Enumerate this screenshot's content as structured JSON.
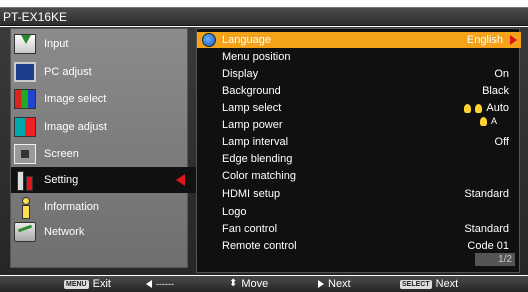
{
  "title": "PT-EX16KE",
  "sidebar": {
    "items": [
      {
        "label": "Input",
        "icon": "input-icon"
      },
      {
        "label": "PC adjust",
        "icon": "pc-adjust-icon"
      },
      {
        "label": "Image select",
        "icon": "image-select-icon"
      },
      {
        "label": "Image adjust",
        "icon": "image-adjust-icon"
      },
      {
        "label": "Screen",
        "icon": "screen-icon"
      },
      {
        "label": "Setting",
        "icon": "setting-icon",
        "selected": true
      },
      {
        "label": "Information",
        "icon": "information-icon"
      },
      {
        "label": "Network",
        "icon": "network-icon"
      }
    ]
  },
  "panel": {
    "rows": [
      {
        "label": "Language",
        "value": "English",
        "selected": true
      },
      {
        "label": "Menu position",
        "value": ""
      },
      {
        "label": "Display",
        "value": "On"
      },
      {
        "label": "Background",
        "value": "Black"
      },
      {
        "label": "Lamp select",
        "value": "Auto"
      },
      {
        "label": "Lamp power",
        "value": ""
      },
      {
        "label": "Lamp interval",
        "value": "Off"
      },
      {
        "label": "Edge blending",
        "value": ""
      },
      {
        "label": "Color matching",
        "value": ""
      },
      {
        "label": "HDMI setup",
        "value": "Standard"
      },
      {
        "label": "Logo",
        "value": ""
      },
      {
        "label": "Fan control",
        "value": "Standard"
      },
      {
        "label": "Remote control",
        "value": "Code 01"
      }
    ],
    "lamp_power_icon_text": "A",
    "page": "1/2"
  },
  "footer": {
    "menu_key": "MENU",
    "exit": "Exit",
    "back_line": "------",
    "move": "Move",
    "next1": "Next",
    "select_key": "SELECT",
    "next2": "Next"
  },
  "colors": {
    "highlight": "#f3a21a",
    "arrow_red": "#e0141c"
  }
}
